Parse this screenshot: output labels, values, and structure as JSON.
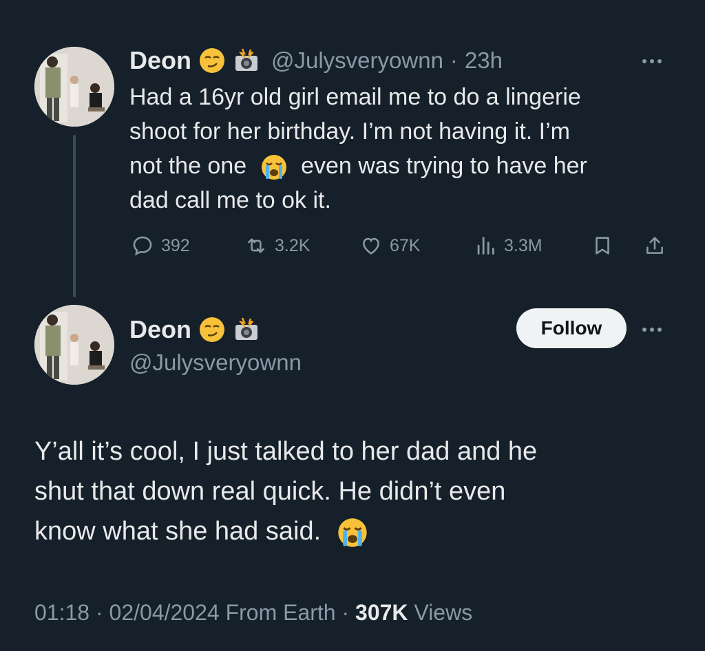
{
  "thread_parent": {
    "name": "Deon",
    "badges": [
      "smirk-emoji",
      "camera-flash-emoji"
    ],
    "handle": "@Julysveryownn",
    "sep": "·",
    "time": "23h",
    "lines": [
      "Had a 16yr old girl email me to do a lingerie",
      "shoot for her birthday. I’m not having it. I’m",
      "not the one",
      "even was trying to have her",
      "dad call me to ok it."
    ],
    "inline_emoji": "loudly-crying-emoji",
    "actions": {
      "replies": "392",
      "retweets": "3.2K",
      "likes": "67K",
      "views": "3.3M"
    }
  },
  "main_tweet": {
    "name": "Deon",
    "handle": "@Julysveryownn",
    "follow_label": "Follow",
    "lines": [
      "Y’all it’s cool, I just talked to her dad and he",
      "shut that down real quick. He didn’t even",
      "know what she had said."
    ],
    "trailing_emoji": "loudly-crying-emoji",
    "meta": {
      "time": "01:18",
      "sep": "·",
      "date": "02/04/2024",
      "source": "From Earth",
      "sep2": "·",
      "views_count": "307K",
      "views_label": "Views"
    }
  },
  "colors": {
    "background": "#15202b",
    "text": "#e7e9ea",
    "secondary": "#8b98a5",
    "thread_line": "#3e4a57"
  }
}
